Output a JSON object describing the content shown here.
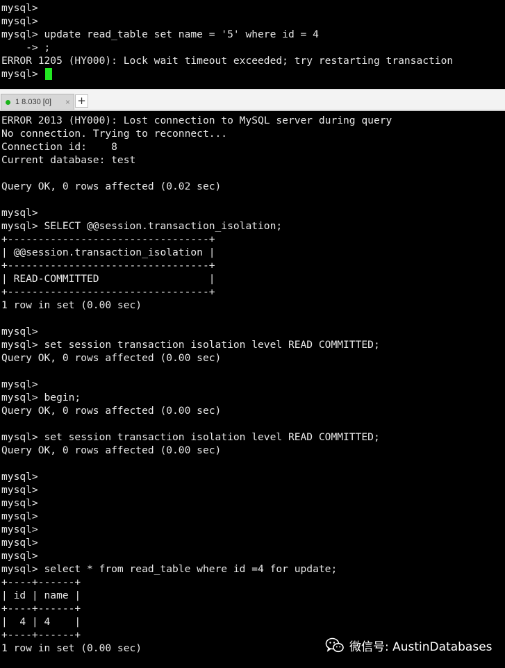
{
  "top_pane": {
    "lines": [
      "mysql>",
      "mysql>",
      "mysql> update read_table set name = '5' where id = 4",
      "    -> ;",
      "ERROR 1205 (HY000): Lock wait timeout exceeded; try restarting transaction",
      "mysql> "
    ],
    "cursor_color": "#22e822"
  },
  "tab_bar": {
    "active_tab_label": "1 8.030 [0]",
    "close_glyph": "×",
    "add_glyph": "+",
    "status_color": "#19b419"
  },
  "bottom_pane": {
    "lines": [
      "ERROR 2013 (HY000): Lost connection to MySQL server during query",
      "No connection. Trying to reconnect...",
      "Connection id:    8",
      "Current database: test",
      "",
      "Query OK, 0 rows affected (0.02 sec)",
      "",
      "mysql>",
      "mysql> SELECT @@session.transaction_isolation;",
      "+---------------------------------+",
      "| @@session.transaction_isolation |",
      "+---------------------------------+",
      "| READ-COMMITTED                  |",
      "+---------------------------------+",
      "1 row in set (0.00 sec)",
      "",
      "mysql>",
      "mysql> set session transaction isolation level READ COMMITTED;",
      "Query OK, 0 rows affected (0.00 sec)",
      "",
      "mysql>",
      "mysql> begin;",
      "Query OK, 0 rows affected (0.00 sec)",
      "",
      "mysql> set session transaction isolation level READ COMMITTED;",
      "Query OK, 0 rows affected (0.00 sec)",
      "",
      "mysql>",
      "mysql>",
      "mysql>",
      "mysql>",
      "mysql>",
      "mysql>",
      "mysql>",
      "mysql> select * from read_table where id =4 for update;",
      "+----+------+",
      "| id | name |",
      "+----+------+",
      "|  4 | 4    |",
      "+----+------+",
      "1 row in set (0.00 sec)"
    ]
  },
  "watermark": {
    "text": "微信号: AustinDatabases",
    "icon": "wechat-icon"
  },
  "colors": {
    "terminal_bg": "#000000",
    "terminal_fg": "#e8e8e8",
    "tab_bar_bg": "#f3f3f3"
  }
}
